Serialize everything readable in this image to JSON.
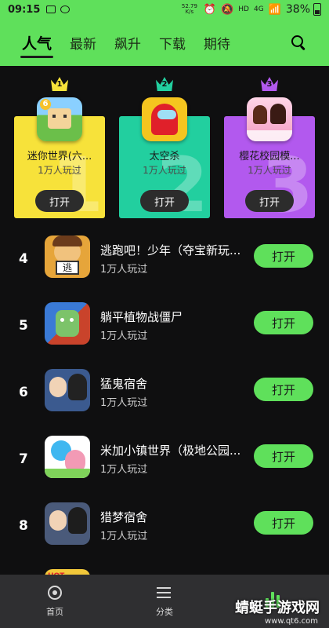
{
  "status_bar": {
    "time": "09:15",
    "speed": "52.79 K/s",
    "network": "4G",
    "hd": "HD",
    "battery": "38%"
  },
  "tabs": [
    "人气",
    "最新",
    "飙升",
    "下载",
    "期待"
  ],
  "active_tab": 0,
  "top3": [
    {
      "rank": "1",
      "name": "迷你世界(六...",
      "players": "1万人玩过",
      "open_label": "打开",
      "color": "#f7e23a",
      "crown_color": "#f7e23a"
    },
    {
      "rank": "2",
      "name": "太空杀",
      "players": "1万人玩过",
      "open_label": "打开",
      "color": "#22cf9f",
      "crown_color": "#22cf9f"
    },
    {
      "rank": "3",
      "name": "樱花校园模...",
      "players": "1万人玩过",
      "open_label": "打开",
      "color": "#b259ee",
      "crown_color": "#b259ee"
    }
  ],
  "list": [
    {
      "rank": "4",
      "title": "逃跑吧！少年（夺宝新玩...",
      "players": "1万人玩过",
      "open_label": "打开",
      "icon_badge": "逃"
    },
    {
      "rank": "5",
      "title": "躺平植物战僵尸",
      "players": "1万人玩过",
      "open_label": "打开"
    },
    {
      "rank": "6",
      "title": "猛鬼宿舍",
      "players": "1万人玩过",
      "open_label": "打开"
    },
    {
      "rank": "7",
      "title": "米加小镇世界（极地公园...",
      "players": "1万人玩过",
      "open_label": "打开"
    },
    {
      "rank": "8",
      "title": "猎梦宿舍",
      "players": "1万人玩过",
      "open_label": "打开"
    }
  ],
  "partial_row_badge": "HOT",
  "nav": [
    {
      "label": "首页",
      "icon": "home-icon"
    },
    {
      "label": "分类",
      "icon": "category-icon"
    },
    {
      "label": "",
      "icon": "ranking-icon"
    }
  ],
  "watermark": {
    "text": "蜻蜓手游戏网",
    "url": "www.qt6.com"
  },
  "colors": {
    "accent": "#5fe05b",
    "background": "#0f0f10",
    "nav_bg": "#2f2f31"
  }
}
